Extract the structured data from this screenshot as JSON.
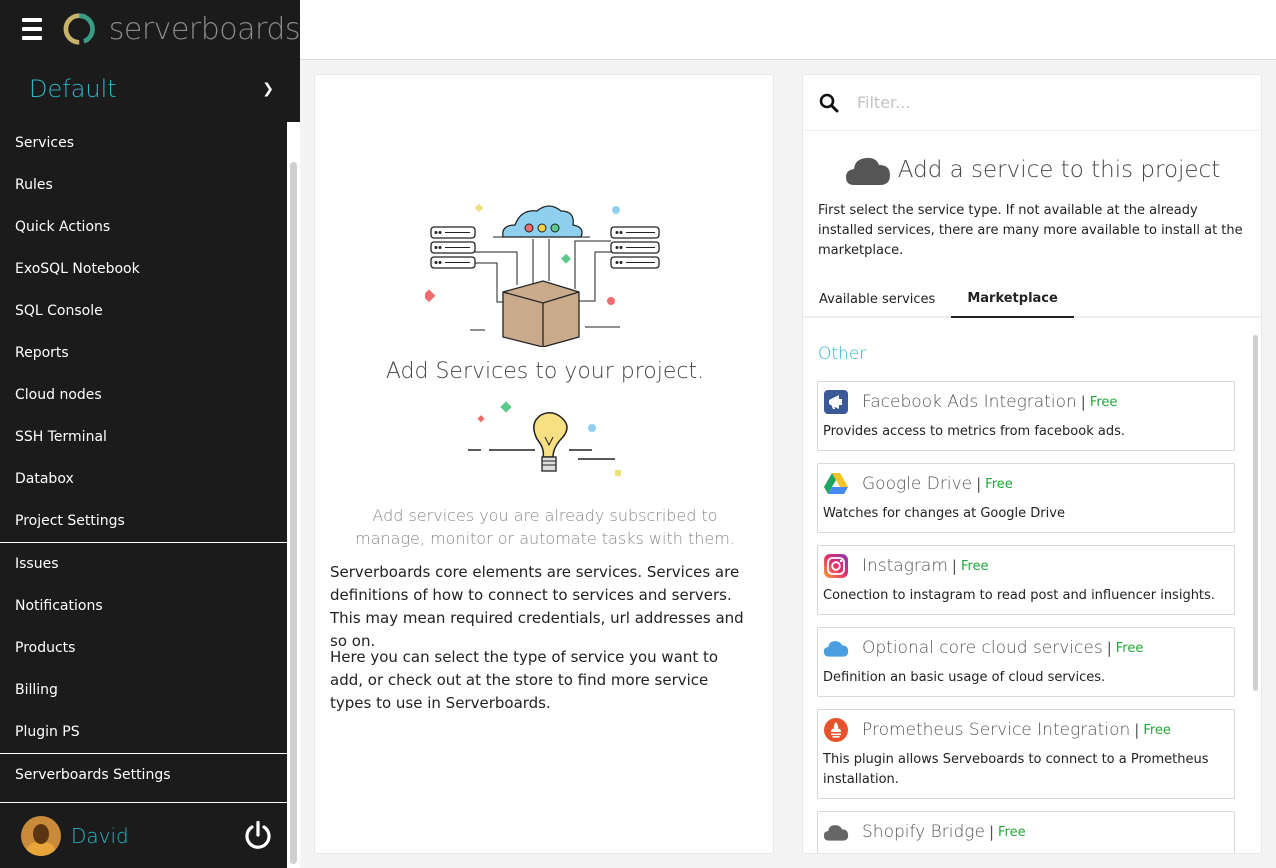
{
  "brand": {
    "name": "serverboards"
  },
  "project": {
    "name": "Default"
  },
  "nav": {
    "group1": [
      "Services",
      "Rules",
      "Quick Actions",
      "ExoSQL Notebook",
      "SQL Console",
      "Reports",
      "Cloud nodes",
      "SSH Terminal",
      "Databox",
      "Project Settings"
    ],
    "group2": [
      "Issues",
      "Notifications",
      "Products",
      "Billing",
      "Plugin PS"
    ],
    "group3": [
      "Serverboards Settings"
    ]
  },
  "user": {
    "name": "David"
  },
  "left": {
    "title": "Add Services to your project.",
    "subtitle": "Add services you are already subscribed to manage, monitor or automate tasks with them.",
    "p1": "Serverboards core elements are services. Services are definitions of how to connect to services and servers. This may mean required credentials, url addresses and so on.",
    "p2": "Here you can select the type of service you want to add, or check out at the store to find more service types to use in Serverboards."
  },
  "right": {
    "filter_placeholder": "Filter...",
    "heading": "Add a service to this project",
    "intro": "First select the service type. If not available at the already installed services, there are many more available to install at the marketplace.",
    "tabs": [
      "Available services",
      "Marketplace"
    ],
    "active_tab": "Marketplace",
    "category": "Other",
    "services": [
      {
        "name": "Facebook Ads Integration",
        "price": "Free",
        "desc": "Provides access to metrics from facebook ads.",
        "icon": "facebook-ads-icon"
      },
      {
        "name": "Google Drive",
        "price": "Free",
        "desc": "Watches for changes at Google Drive",
        "icon": "google-drive-icon"
      },
      {
        "name": "Instagram",
        "price": "Free",
        "desc": "Conection to instagram to read post and influencer insights.",
        "icon": "instagram-icon"
      },
      {
        "name": "Optional core cloud services",
        "price": "Free",
        "desc": "Definition an basic usage of cloud services.",
        "icon": "cloud-icon"
      },
      {
        "name": "Prometheus Service Integration",
        "price": "Free",
        "desc": "This plugin allows Serveboards to connect to a Prometheus installation.",
        "icon": "prometheus-icon"
      },
      {
        "name": "Shopify Bridge",
        "price": "Free",
        "desc": "",
        "icon": "cloud-icon"
      }
    ]
  },
  "colors": {
    "accent": "#2bb6c7",
    "sidebar": "#1b1b1b",
    "free": "#22a838"
  }
}
